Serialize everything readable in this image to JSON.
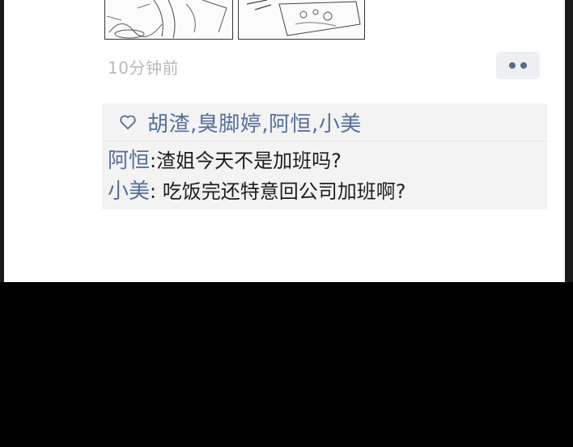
{
  "post": {
    "time_ago": "10分钟前",
    "more_icon": "more-dots-icon"
  },
  "likes": {
    "icon": "heart-outline-icon",
    "names": "胡渣,臭脚婷,阿恒,小美"
  },
  "comments": [
    {
      "author": "阿恒",
      "separator": ":",
      "text": "渣姐今天不是加班吗?"
    },
    {
      "author": "小美",
      "separator": ": ",
      "text": "吃饭完还特意回公司加班啊?"
    }
  ],
  "colors": {
    "link": "#56709a",
    "timestamp": "#b9b9b9",
    "panel": "#f3f3f4"
  }
}
